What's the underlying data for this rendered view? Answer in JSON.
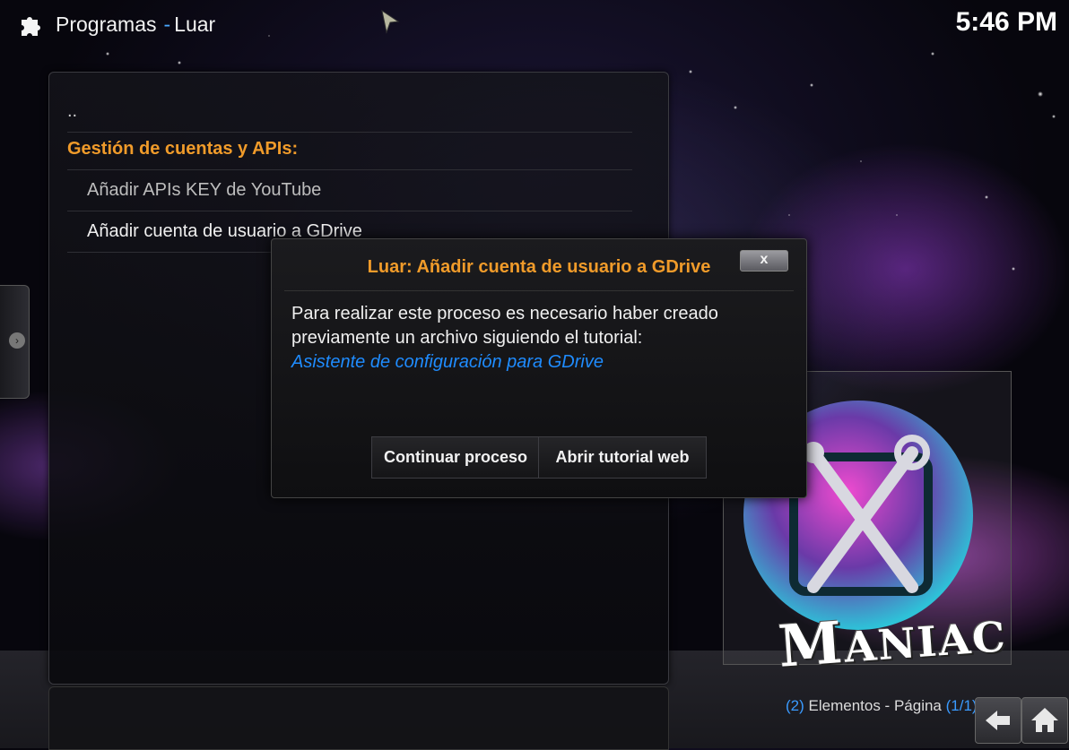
{
  "header": {
    "section": "Programas",
    "separator": "-",
    "addon": "Luar",
    "clock": "5:46 PM",
    "icons": {
      "addon": "puzzle-icon",
      "cursor": "pointer-cursor-icon"
    }
  },
  "list": {
    "parent": "..",
    "header": "Gestión de cuentas y APIs:",
    "items": [
      {
        "label": "Añadir APIs KEY de YouTube"
      },
      {
        "label": "Añadir cuenta de usuario a GDrive"
      }
    ]
  },
  "dialog": {
    "title": "Luar: Añadir cuenta de usuario a GDrive",
    "close_label": "x",
    "message_line1": "Para realizar este proceso es necesario haber creado",
    "message_line2": "previamente un archivo siguiendo el tutorial:",
    "link_text": "Asistente de configuración para GDrive",
    "buttons": {
      "continue": "Continuar proceso",
      "tutorial": "Abrir tutorial web"
    }
  },
  "footer": {
    "count": "(2)",
    "items_label": "Elementos - Página",
    "page": "(1/1)",
    "icons": {
      "back": "back-arrow-icon",
      "home": "home-icon"
    }
  },
  "thumbnail": {
    "overlay_text": "Maniac"
  },
  "colors": {
    "accent_orange": "#f09b2a",
    "link_blue": "#1f8cff",
    "page_blue": "#3a9bff"
  }
}
